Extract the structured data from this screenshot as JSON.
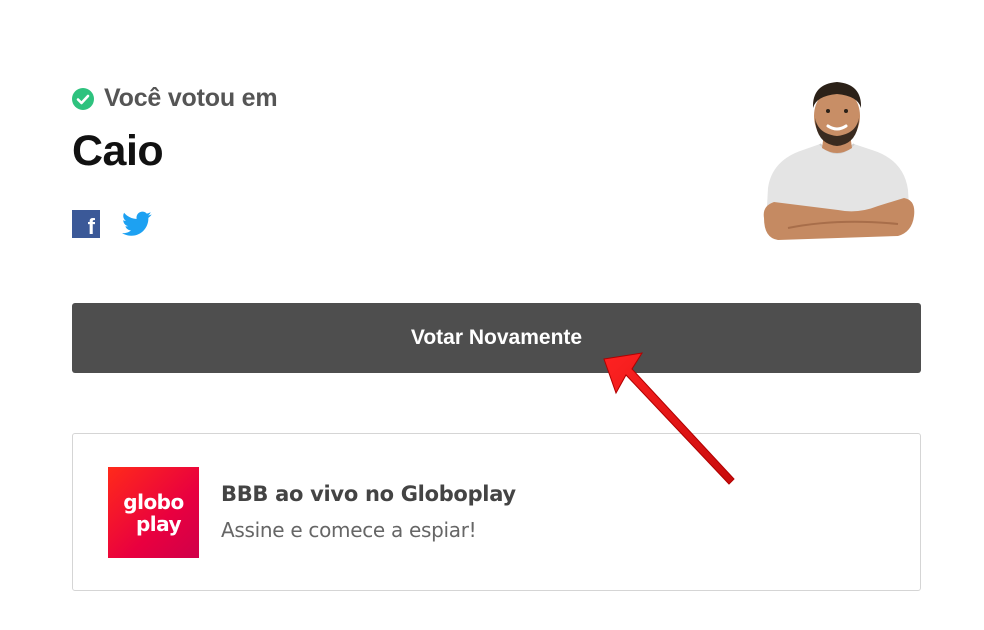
{
  "vote_confirmation": {
    "voted_label": "Você votou em",
    "candidate_name": "Caio"
  },
  "share": {
    "facebook_icon": "facebook-icon",
    "facebook_glyph": "f",
    "twitter_icon": "twitter-icon"
  },
  "avatar": {
    "icon": "candidate-photo"
  },
  "actions": {
    "vote_again_label": "Votar Novamente"
  },
  "promo": {
    "logo_line1": "globo",
    "logo_line2": "play",
    "title": "BBB ao vivo no Globoplay",
    "subtitle": "Assine e comece a espiar!"
  },
  "colors": {
    "check_green": "#2ec27e",
    "button_bg": "#4e4e4e",
    "facebook_blue": "#3b5998",
    "twitter_blue": "#1da1f2",
    "globoplay_red": "#ff2a1a",
    "arrow_red": "#e01010"
  }
}
